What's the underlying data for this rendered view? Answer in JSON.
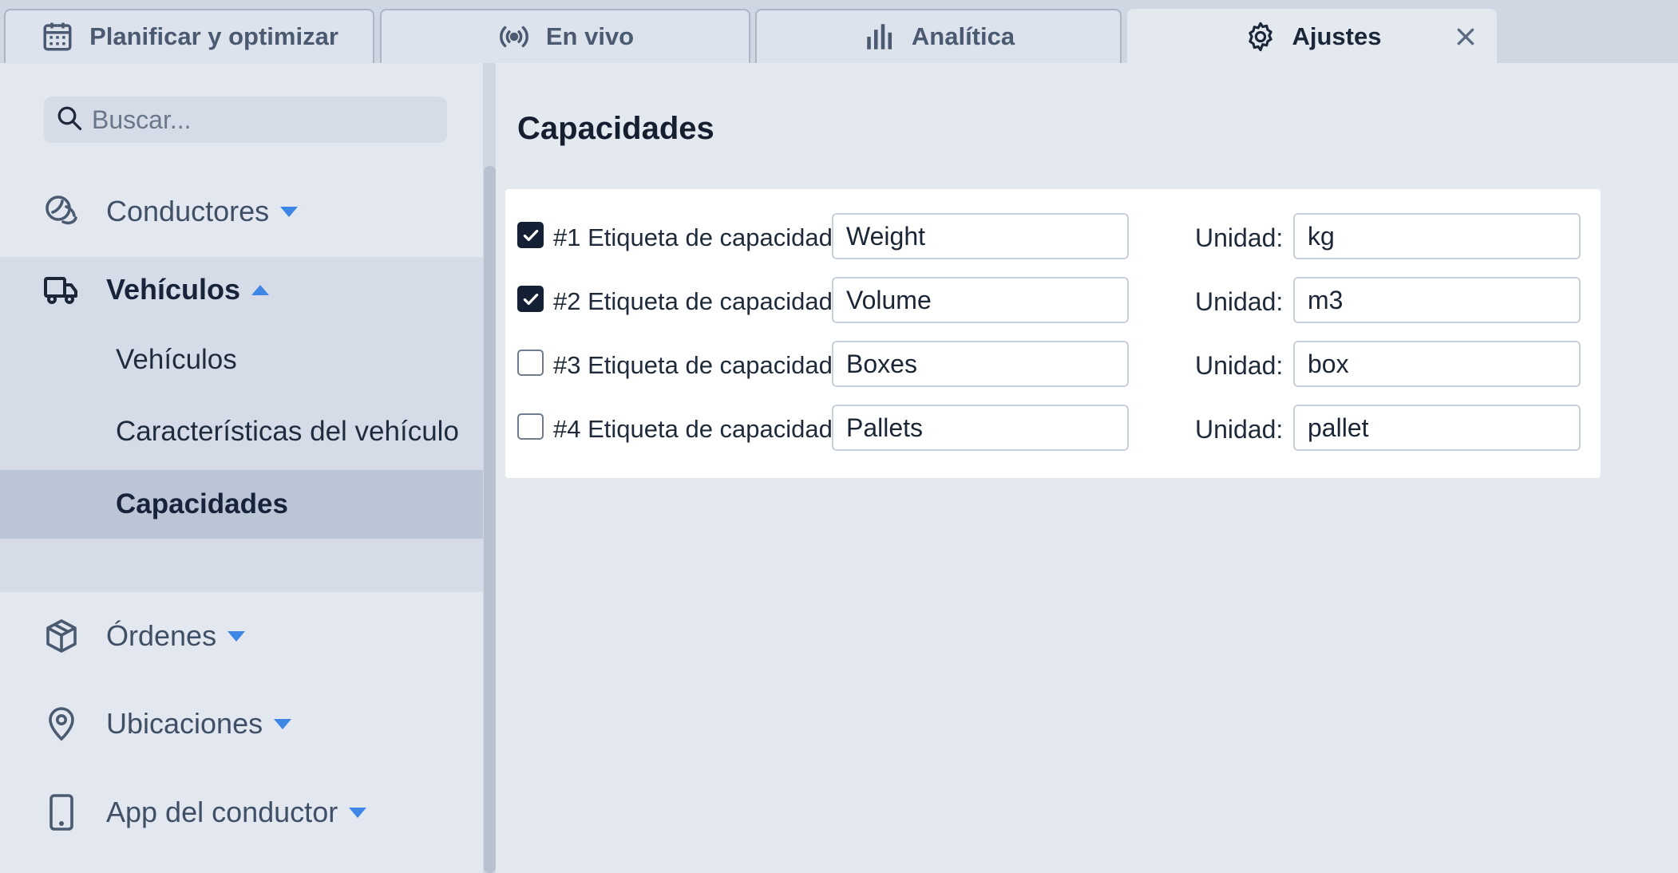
{
  "tabs": [
    {
      "label": "Planificar y optimizar",
      "icon": "calendar-icon",
      "active": false
    },
    {
      "label": "En vivo",
      "icon": "broadcast-icon",
      "active": false
    },
    {
      "label": "Analítica",
      "icon": "bar-chart-icon",
      "active": false
    },
    {
      "label": "Ajustes",
      "icon": "gear-icon",
      "active": true
    }
  ],
  "search": {
    "placeholder": "Buscar..."
  },
  "sidebar": {
    "conductores": {
      "label": "Conductores",
      "icon": "steering-icon"
    },
    "vehiculos": {
      "label": "Vehículos",
      "icon": "truck-icon",
      "subitems": [
        "Vehículos",
        "Características del vehículo",
        "Capacidades"
      ]
    },
    "ordenes": {
      "label": "Órdenes",
      "icon": "package-icon"
    },
    "ubicaciones": {
      "label": "Ubicaciones",
      "icon": "map-pin-icon"
    },
    "app_conductor": {
      "label": "App del conductor",
      "icon": "smartphone-icon"
    }
  },
  "main": {
    "title": "Capacidades",
    "unit_label": "Unidad:",
    "capacities": [
      {
        "label": "#1 Etiqueta de capacidad:",
        "value": "Weight",
        "unit": "kg",
        "checked": true
      },
      {
        "label": "#2 Etiqueta de capacidad:",
        "value": "Volume",
        "unit": "m3",
        "checked": true
      },
      {
        "label": "#3 Etiqueta de capacidad:",
        "value": "Boxes",
        "unit": "box",
        "checked": false
      },
      {
        "label": "#4 Etiqueta de capacidad:",
        "value": "Pallets",
        "unit": "pallet",
        "checked": false
      }
    ]
  },
  "colors": {
    "accent": "#3d86e6",
    "checkbox_checked": "#142033",
    "sidebar_active": "#bac6d6"
  }
}
